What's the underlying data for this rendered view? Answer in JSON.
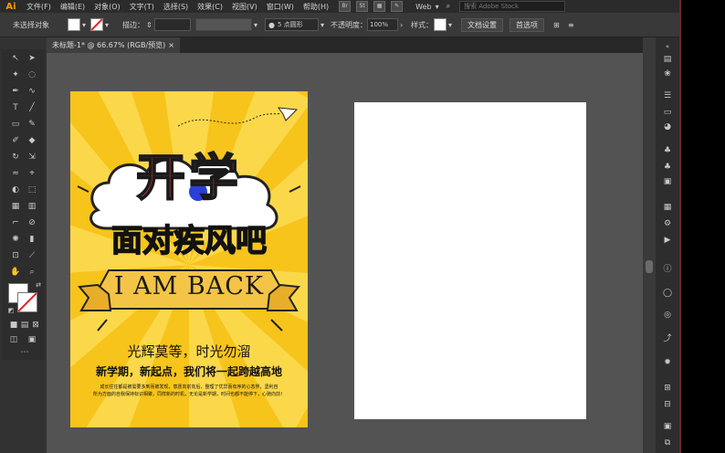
{
  "app": {
    "logo": "Ai"
  },
  "menu": {
    "items": [
      "文件(F)",
      "编辑(E)",
      "对象(O)",
      "文字(T)",
      "选择(S)",
      "效果(C)",
      "视图(V)",
      "窗口(W)",
      "帮助(H)"
    ],
    "chips": [
      "Br",
      "St"
    ],
    "workspace": "Web",
    "search_placeholder": "搜索 Adobe Stock"
  },
  "control": {
    "no_selection": "未选择对象",
    "stroke_label": "描边：",
    "brush_label": "5 点圆形",
    "opacity_label": "不透明度：",
    "opacity_value": "100%",
    "style_label": "样式：",
    "doc_setup": "文档设置",
    "preferences": "首选项"
  },
  "document": {
    "tab_title": "未标题-1* @ 66.67% (RGB/预览)",
    "tab_close": "×"
  },
  "poster": {
    "headline": "开学",
    "subheadline": "面对疾风吧",
    "banner": "I AM BACK",
    "slogan": "光辉莫等，时光勿溜",
    "tagline": "新学期，新起点，我们将一起跨越高地",
    "body_line1": "成长往往都是被需要多到而被发现，意愿向前向后，整理了优异而有序的心态界，坚利自",
    "body_line2": "所为方面的自我保持标识相聚，同样新的时机，无论是新学期，时间也都不能停下，心驰向前！",
    "colors": {
      "background": "#f7c41c",
      "ray": "#fbd84a",
      "headline": "#e8474b",
      "subheadline": "#1a9a9a",
      "banner": "#f4c446"
    }
  },
  "colors": {
    "app_bg": "#323232",
    "canvas": "#535353",
    "artboard": "#ffffff",
    "logo": "#ff9a00"
  }
}
